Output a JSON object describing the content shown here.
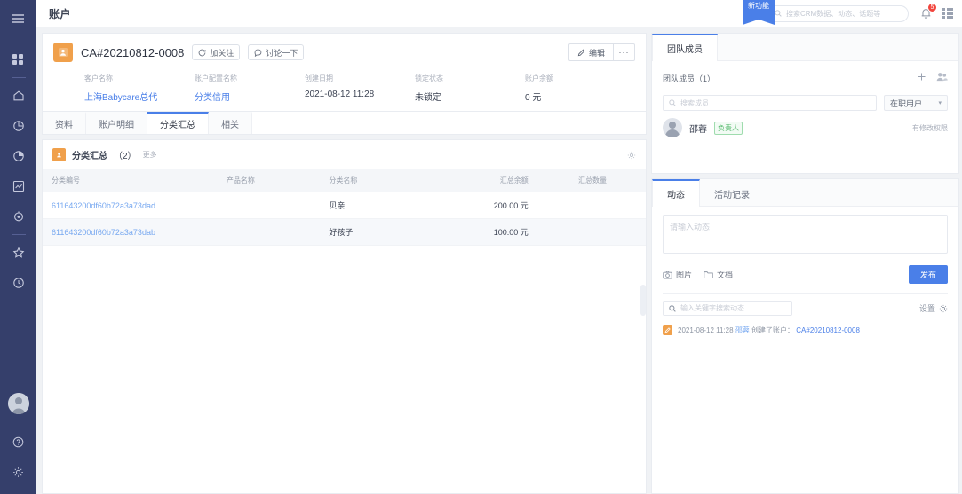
{
  "sidebar": {
    "items": [
      {
        "name": "menu-toggle",
        "icon": "hamburger-icon"
      },
      {
        "name": "apps-grid",
        "icon": "grid-icon"
      },
      {
        "name": "home",
        "icon": "home-icon"
      },
      {
        "name": "clock-chart",
        "icon": "pie-outline-icon"
      },
      {
        "name": "pie-report",
        "icon": "pie-filled-icon"
      },
      {
        "name": "analytics",
        "icon": "line-chart-icon"
      },
      {
        "name": "target",
        "icon": "target-icon"
      },
      {
        "name": "favorites",
        "icon": "star-icon"
      },
      {
        "name": "recent",
        "icon": "clock-icon"
      }
    ],
    "bottom": [
      {
        "name": "user-avatar",
        "icon": "avatar-icon"
      },
      {
        "name": "help",
        "icon": "question-icon"
      },
      {
        "name": "settings",
        "icon": "gear-icon"
      }
    ]
  },
  "topbar": {
    "title": "账户",
    "ribbon_label": "新功能",
    "search_placeholder": "搜索CRM数据、动态、话题等",
    "notification_count": "5"
  },
  "record": {
    "title": "CA#20210812-0008",
    "follow_label": "加关注",
    "discuss_label": "讨论一下",
    "edit_label": "编辑",
    "more_label": "···",
    "fields": [
      {
        "label": "客户名称",
        "value": "上海Babycare总代",
        "link": true
      },
      {
        "label": "账户配置名称",
        "value": "分类信用",
        "link": true
      },
      {
        "label": "创建日期",
        "value": "2021-08-12 11:28",
        "link": false
      },
      {
        "label": "锁定状态",
        "value": "未锁定",
        "link": false
      },
      {
        "label": "账户余额",
        "value": "0 元",
        "link": false
      }
    ]
  },
  "tabs": [
    {
      "label": "资料",
      "active": false
    },
    {
      "label": "账户明细",
      "active": false
    },
    {
      "label": "分类汇总",
      "active": true
    },
    {
      "label": "相关",
      "active": false
    }
  ],
  "list": {
    "title": "分类汇总",
    "count": "（2）",
    "more_label": "更多",
    "columns": [
      "分类编号",
      "产品名称",
      "分类名称",
      "汇总余额",
      "汇总数量",
      ""
    ],
    "rows": [
      {
        "id": "611643200df60b72a3a73dad",
        "product": "",
        "category": "贝亲",
        "balance": "200.00 元",
        "qty": "",
        "extra": ""
      },
      {
        "id": "611643200df60b72a3a73dab",
        "product": "",
        "category": "好孩子",
        "balance": "100.00 元",
        "qty": "",
        "extra": ""
      }
    ]
  },
  "team": {
    "tab_label": "团队成员",
    "section_title": "团队成员（1）",
    "search_placeholder": "搜索成员",
    "filter_value": "在职用户",
    "members": [
      {
        "name": "邵蓉",
        "badge": "负责人",
        "permission": "有修改权限"
      }
    ]
  },
  "feed": {
    "tabs": [
      {
        "label": "动态",
        "active": true
      },
      {
        "label": "活动记录",
        "active": false
      }
    ],
    "composer_placeholder": "请输入动态",
    "image_label": "图片",
    "doc_label": "文档",
    "publish_label": "发布",
    "search_placeholder": "输入关键字搜索动态",
    "settings_label": "设置",
    "items": [
      {
        "time": "2021-08-12 11:28",
        "user": "邵蓉",
        "action": "创建了账户：",
        "record": "CA#20210812-0008"
      }
    ]
  },
  "colors": {
    "sidebar_bg": "#353f6b",
    "accent": "#4a7fe8",
    "orange": "#f0a04b",
    "badge_red": "#f2453d",
    "green": "#52b86a"
  }
}
